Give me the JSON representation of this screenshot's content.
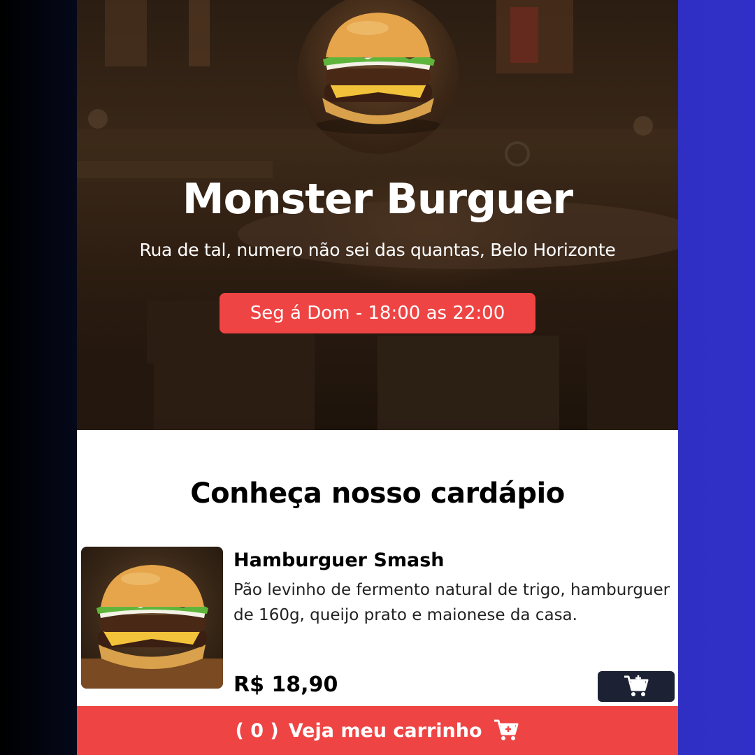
{
  "restaurant": {
    "name": "Monster Burguer",
    "address": "Rua de tal, numero não sei das quantas, Belo Horizonte",
    "hours": "Seg á Dom - 18:00 as 22:00",
    "logo_icon": "burger-logo-icon"
  },
  "menu": {
    "title": "Conheça nosso cardápio",
    "items": [
      {
        "name": "Hamburguer Smash",
        "description": "Pão levinho de fermento natural de trigo, hamburguer de 160g, queijo prato e maionese da casa.",
        "price": "R$ 18,90",
        "add_icon": "cart-plus-icon"
      }
    ]
  },
  "cart": {
    "count_text": "( 0 )",
    "label": "Veja meu carrinho",
    "icon": "cart-plus-icon"
  },
  "colors": {
    "accent": "#ef4444",
    "button_dark": "#1c2233",
    "background_left": "#000000",
    "background_right": "#3030c8"
  }
}
